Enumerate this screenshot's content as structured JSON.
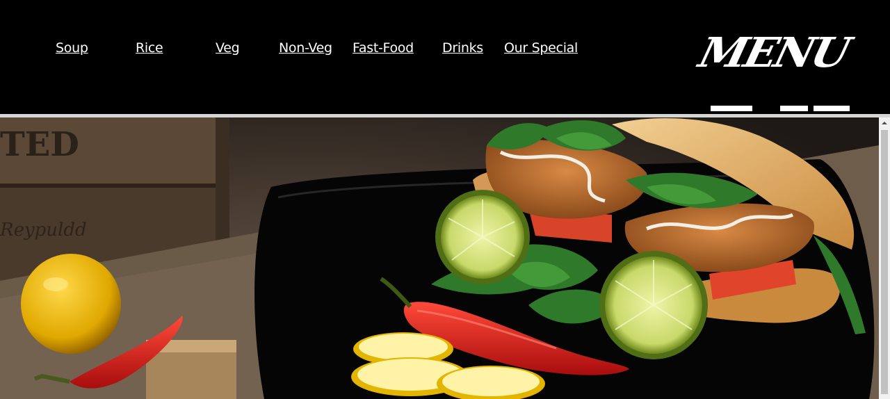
{
  "nav": {
    "items": [
      {
        "label": "Soup"
      },
      {
        "label": "Rice"
      },
      {
        "label": "Veg"
      },
      {
        "label": "Non-Veg"
      },
      {
        "label": "Fast-Food"
      },
      {
        "label": "Drinks"
      },
      {
        "label": "Our Special"
      }
    ]
  },
  "logo": {
    "text": "MENU"
  },
  "colors": {
    "header_bg": "#000000",
    "link": "#ffffff",
    "divider": "#d6d6d6"
  },
  "icons": {
    "scroll_up": "chevron-up-icon"
  }
}
